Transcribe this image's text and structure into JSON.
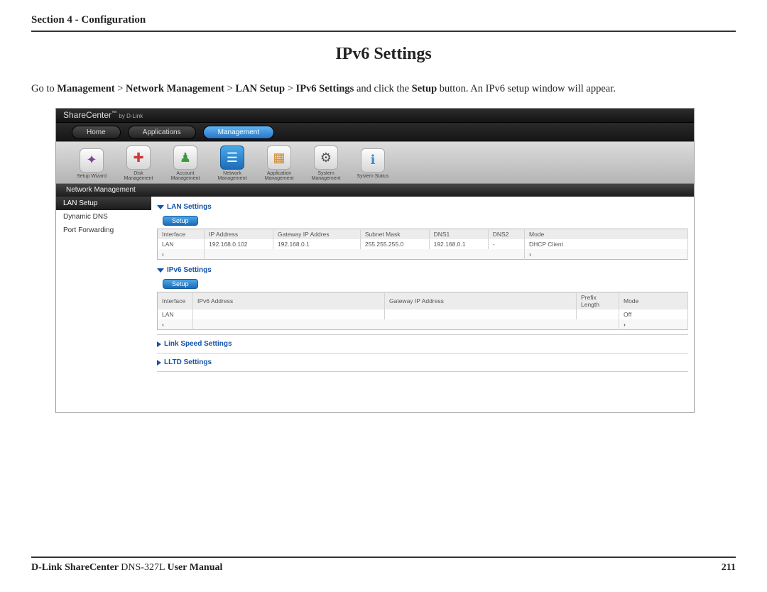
{
  "doc": {
    "section_header": "Section 4 - Configuration",
    "page_title": "IPv6 Settings",
    "instruction_pre": "Go to ",
    "instruction_path1": "Management",
    "instruction_sep": " > ",
    "instruction_path2": "Network Management",
    "instruction_path3": "LAN Setup",
    "instruction_path4": "IPv6 Settings",
    "instruction_mid": " and click the ",
    "instruction_btn": "Setup",
    "instruction_post": " button. An IPv6 setup window will appear.",
    "footer_lead": "D-Link ShareCenter ",
    "footer_model": "DNS-327L ",
    "footer_tail": "User Manual",
    "page_num": "211"
  },
  "product": {
    "name": "ShareCenter",
    "tm": "™",
    "by": "by D-Link"
  },
  "nav": {
    "home": "Home",
    "apps": "Applications",
    "mgmt": "Management"
  },
  "icons": {
    "wizard": "Setup Wizard",
    "disk": "Disk Management",
    "account": "Account Management",
    "network": "Network Management",
    "app": "Application Management",
    "system": "System Management",
    "status": "System Status"
  },
  "section_label": "Network Management",
  "sidebar": {
    "lan": "LAN Setup",
    "ddns": "Dynamic DNS",
    "pfwd": "Port Forwarding"
  },
  "panels": {
    "lan_title": "LAN Settings",
    "ipv6_title": "IPv6 Settings",
    "linkspeed_title": "Link Speed Settings",
    "lltd_title": "LLTD Settings",
    "setup_label": "Setup"
  },
  "lan_headers": {
    "iface": "Interface",
    "ip": "IP Address",
    "gw": "Gateway IP Addres",
    "mask": "Subnet Mask",
    "dns1": "DNS1",
    "dns2": "DNS2",
    "mode": "Mode"
  },
  "lan_row": {
    "iface": "LAN",
    "ip": "192.168.0.102",
    "gw": "192.168.0.1",
    "mask": "255.255.255.0",
    "dns1": "192.168.0.1",
    "dns2": "-",
    "mode": "DHCP Client"
  },
  "ipv6_headers": {
    "iface": "Interface",
    "addr": "IPv6 Address",
    "gw": "Gateway IP Address",
    "plen": "Prefix Length",
    "mode": "Mode"
  },
  "ipv6_row": {
    "iface": "LAN",
    "addr": "",
    "gw": "",
    "plen": "",
    "mode": "Off"
  },
  "scroll": {
    "left": "‹",
    "right": "›"
  }
}
